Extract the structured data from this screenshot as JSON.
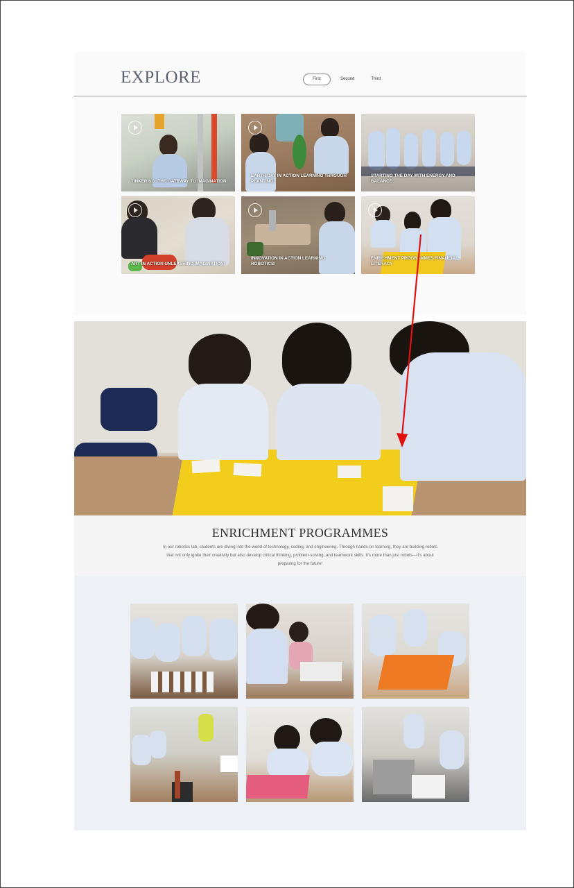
{
  "explore": {
    "title": "EXPLORE",
    "tabs": [
      {
        "label": "First",
        "active": true
      },
      {
        "label": "Second",
        "active": false
      },
      {
        "label": "Third",
        "active": false
      }
    ]
  },
  "tiles": [
    {
      "caption": "TINKERING: THE GATEWAY TO IMAGINATION!"
    },
    {
      "caption": "EARTH DAY IN ACTION LEARNING THROUGH PLANTING!"
    },
    {
      "caption": "STARTING THE DAY WITH ENERGY AND BALANCE"
    },
    {
      "caption": "ART IN ACTION UNLEASHING IMAGINATION!"
    },
    {
      "caption": "INNOVATION IN ACTION LEARNING ROBOTICS!"
    },
    {
      "caption": "ENRICHMENT PROGRAMMES FINANCIAL LITERACY"
    }
  ],
  "enrichment": {
    "title": "ENRICHMENT PROGRAMMES",
    "description": "In our robotics lab, students are diving into the world of technology, coding, and engineering. Through hands-on learning, they are building robots that not only ignite their creativity but also develop critical thinking, problem-solving, and teamwork skills. It's more than just robots—it's about preparing for the future!"
  },
  "colors": {
    "annotation_arrow": "#e0100f",
    "title_gray": "#5a6270",
    "gallery_bg": "#edf0f4"
  }
}
